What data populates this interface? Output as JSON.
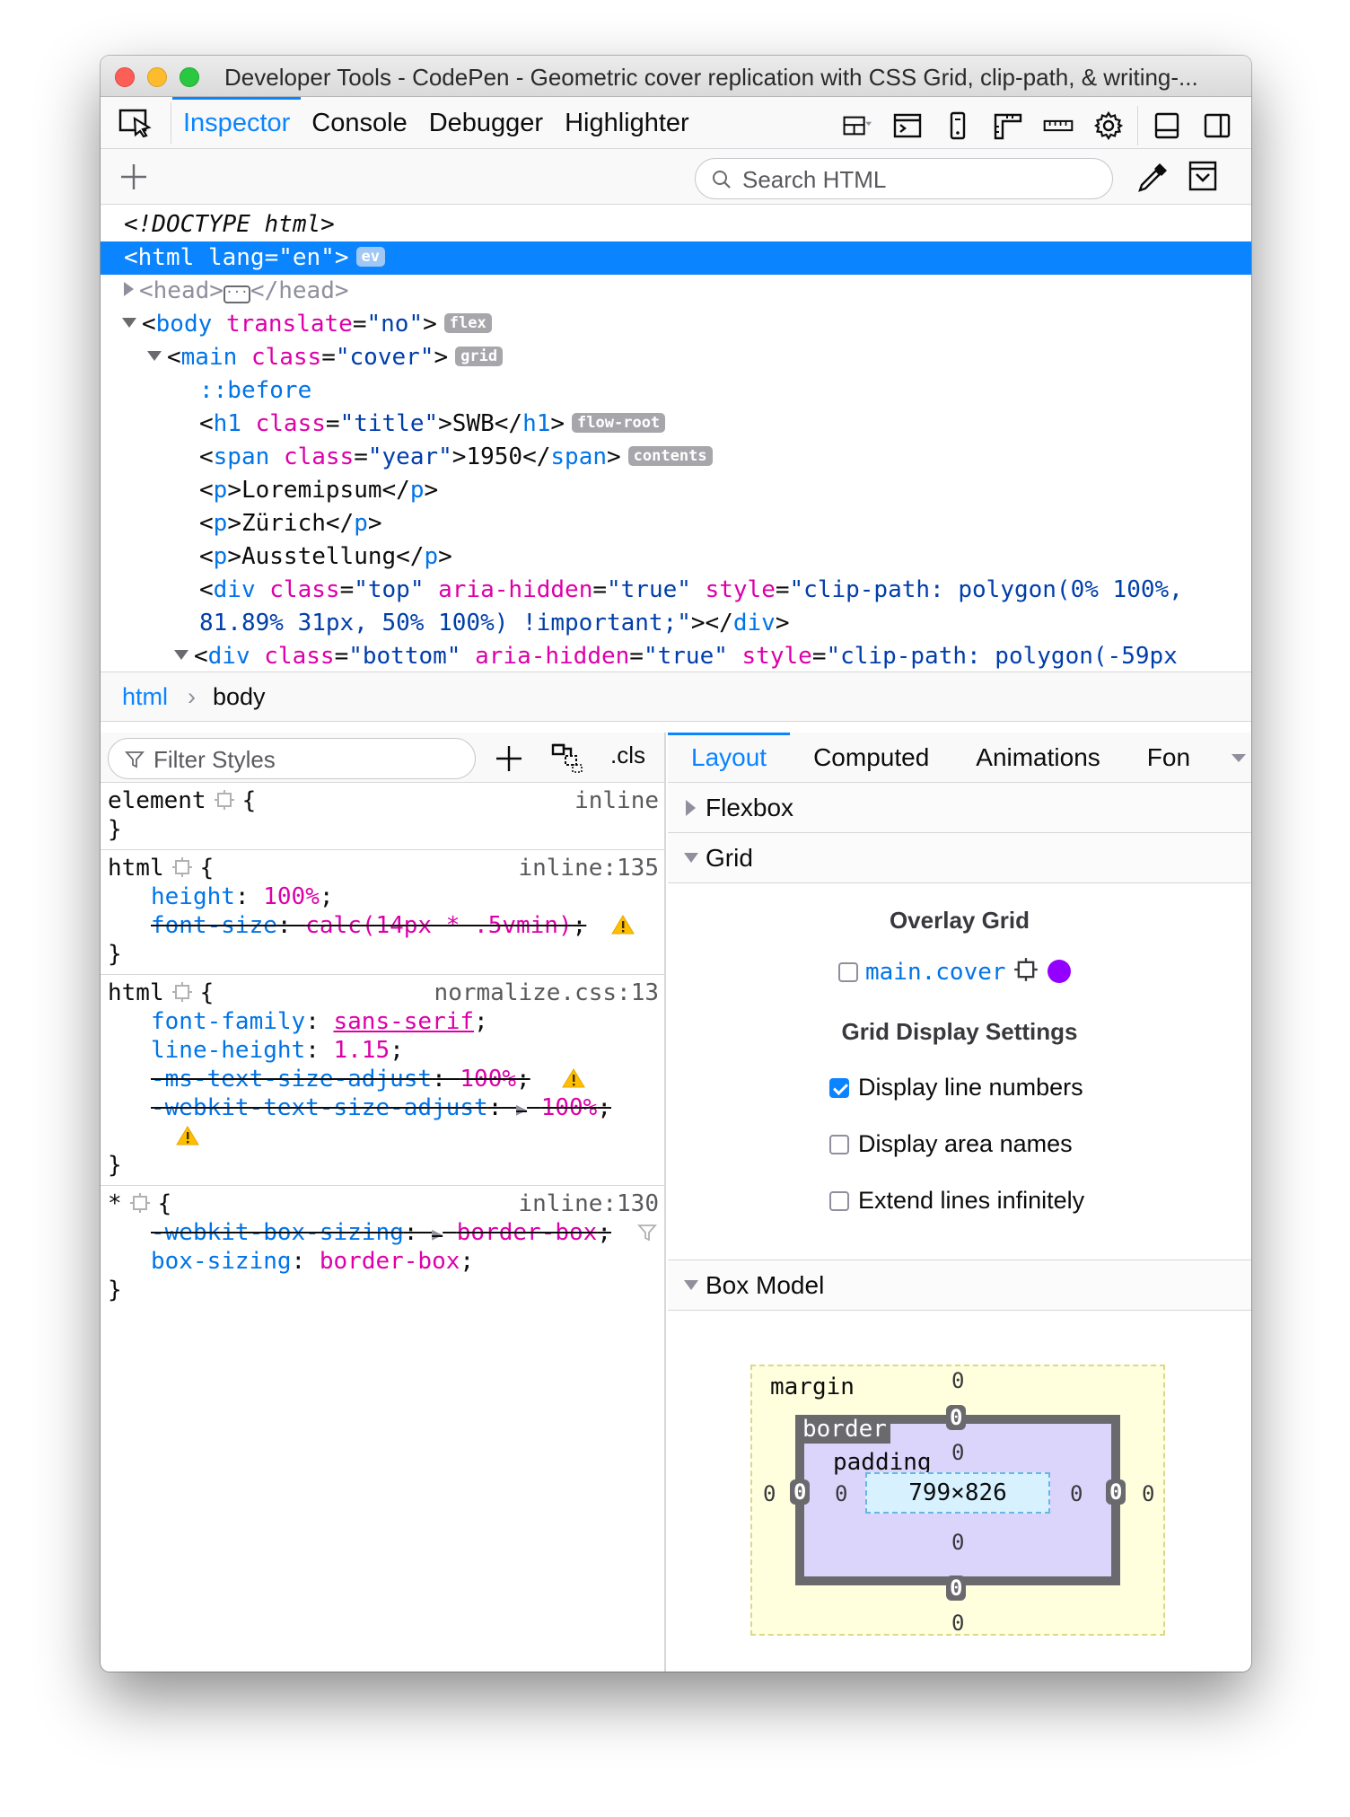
{
  "window": {
    "title": "Developer Tools - CodePen - Geometric cover replication with CSS Grid, clip-path, & writing-..."
  },
  "toolbar": {
    "tabs": [
      "Inspector",
      "Console",
      "Debugger",
      "Highlighter"
    ],
    "active_tab": "Inspector",
    "icons": [
      "element-picker-icon",
      "layout-toggle-icon",
      "frame-icon",
      "responsive-icon",
      "rulers-icon",
      "measure-icon",
      "settings-icon",
      "dock-bottom-icon",
      "dock-side-icon"
    ]
  },
  "search": {
    "placeholder": "Search HTML"
  },
  "markup": {
    "doctype": "<!DOCTYPE html>",
    "html_tag": "html",
    "html_attr": "lang",
    "html_val": "\"en\"",
    "html_badge": "ev",
    "head_open": "<head>",
    "head_close": "</head>",
    "body_tag": "body",
    "body_attr": "translate",
    "body_val": "\"no\"",
    "body_badge": "flex",
    "main_tag": "main",
    "main_attr": "class",
    "main_val": "\"cover\"",
    "main_badge": "grid",
    "before": "::before",
    "h1_tag": "h1",
    "h1_attr": "class",
    "h1_val": "\"title\"",
    "h1_text": "SWB",
    "h1_badge": "flow-root",
    "span_tag": "span",
    "span_attr": "class",
    "span_val": "\"year\"",
    "span_text": "1950",
    "span_badge": "contents",
    "p_tag": "p",
    "p1_text": "Loremipsum",
    "p2_text": "Zürich",
    "p3_text": "Ausstellung",
    "div_tag": "div",
    "top_class_attr": "class",
    "top_class_val": "\"top\"",
    "aria_attr": "aria-hidden",
    "aria_val": "\"true\"",
    "style_attr": "style",
    "top_style_val_1": "\"clip-path: polygon(0% 100%,",
    "top_style_val_2": "81.89% 31px, 50% 100%) !important;\"",
    "bottom_class_val": "\"bottom\"",
    "bottom_style_val": "\"clip-path: polygon(-59px"
  },
  "breadcrumb": [
    "html",
    "body"
  ],
  "rules_toolbar": {
    "filter_placeholder": "Filter Styles",
    "cls_label": ".cls"
  },
  "rules": {
    "r0": {
      "selector": "element",
      "brace_open": "{",
      "brace_close": "}",
      "source": "inline"
    },
    "r1": {
      "selector": "html",
      "brace_open": "{",
      "brace_close": "}",
      "source": "inline:135",
      "d1_prop": "height",
      "d1_val": "100%",
      "d2_prop": "font-size",
      "d2_val": "calc(14px * .5vmin)"
    },
    "r2": {
      "selector": "html",
      "brace_open": "{",
      "brace_close": "}",
      "source": "normalize.css:13",
      "d1_prop": "font-family",
      "d1_val": "sans-serif",
      "d2_prop": "line-height",
      "d2_val": "1.15",
      "d3_prop": "-ms-text-size-adjust",
      "d3_val": "100%",
      "d4_prop": "-webkit-text-size-adjust",
      "d4_val": "100%"
    },
    "r3": {
      "selector": "*",
      "brace_open": "{",
      "brace_close": "}",
      "source": "inline:130",
      "d1_prop": "-webkit-box-sizing",
      "d1_val": "border-box",
      "d2_prop": "box-sizing",
      "d2_val": "border-box"
    }
  },
  "side_tabs": [
    "Layout",
    "Computed",
    "Animations",
    "Fon"
  ],
  "layout": {
    "flexbox_label": "Flexbox",
    "grid_label": "Grid",
    "overlay_title": "Overlay Grid",
    "overlay_item": "main.cover",
    "overlay_color": "#9400ff",
    "settings_title": "Grid Display Settings",
    "settings": [
      {
        "label": "Display line numbers",
        "checked": true
      },
      {
        "label": "Display area names",
        "checked": false
      },
      {
        "label": "Extend lines infinitely",
        "checked": false
      }
    ],
    "box_model_label": "Box Model"
  },
  "box_model": {
    "margin_label": "margin",
    "border_label": "border",
    "padding_label": "padding",
    "content_size": "799×826",
    "margin": {
      "top": "0",
      "right": "0",
      "bottom": "0",
      "left": "0"
    },
    "border": {
      "top": "0",
      "right": "0",
      "bottom": "0",
      "left": "0"
    },
    "padding": {
      "top": "0",
      "right": "0",
      "bottom": "0",
      "left": "0"
    }
  }
}
